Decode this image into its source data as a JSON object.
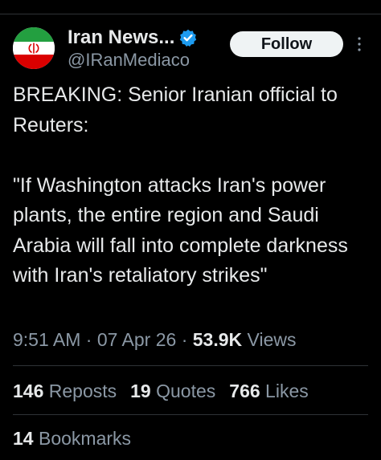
{
  "account": {
    "display_name": "Iran News...",
    "handle": "@IRanMediaco",
    "verified": true
  },
  "follow_label": "Follow",
  "tweet": {
    "text": "BREAKING: Senior Iranian official to Reuters:\n\n\"If Washington attacks Iran's power plants, the entire region and Saudi Arabia will fall into complete darkness with Iran's retaliatory strikes\""
  },
  "meta": {
    "time": "9:51 AM",
    "separator": "·",
    "date": "07 Apr 26",
    "views_count": "53.9K",
    "views_label": "Views"
  },
  "stats": {
    "reposts_count": "146",
    "reposts_label": "Reposts",
    "quotes_count": "19",
    "quotes_label": "Quotes",
    "likes_count": "766",
    "likes_label": "Likes",
    "bookmarks_count": "14",
    "bookmarks_label": "Bookmarks"
  },
  "colors": {
    "background": "#000000",
    "text": "#e7e9ea",
    "secondary": "#8b98a5",
    "verified": "#1d9bf0",
    "divider": "#2f3336"
  },
  "icons": {
    "avatar": "iran-flag-avatar",
    "verified": "verified-badge-icon",
    "more": "more-options-icon"
  }
}
